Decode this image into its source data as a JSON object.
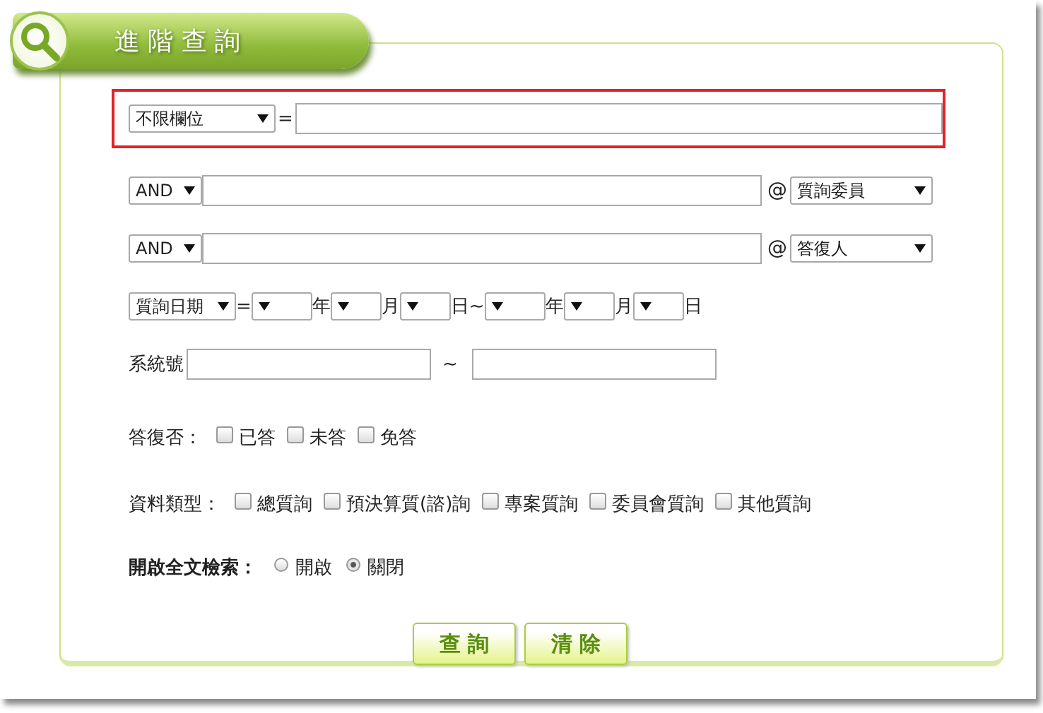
{
  "header": {
    "title": "進 階 查 詢"
  },
  "field_row": {
    "field_select": "不限欄位",
    "equals": "="
  },
  "keyword_rows": [
    {
      "logic": "AND",
      "at": "@",
      "scope": "質詢委員"
    },
    {
      "logic": "AND",
      "at": "@",
      "scope": "答復人"
    }
  ],
  "date_row": {
    "field_select": "質詢日期",
    "equals": "=",
    "units": [
      "年",
      "月",
      "日~",
      "年",
      "月",
      "日"
    ]
  },
  "serial_row": {
    "label": "系統號",
    "separator": "~"
  },
  "answer_row": {
    "label": "答復否：",
    "options": [
      {
        "label": "已答",
        "checked": false
      },
      {
        "label": "未答",
        "checked": false
      },
      {
        "label": "免答",
        "checked": false
      }
    ]
  },
  "type_row": {
    "label": "資料類型：",
    "options": [
      {
        "label": "總質詢",
        "checked": false
      },
      {
        "label": "預決算質(諮)詢",
        "checked": false
      },
      {
        "label": "專案質詢",
        "checked": false
      },
      {
        "label": "委員會質詢",
        "checked": false
      },
      {
        "label": "其他質詢",
        "checked": false
      }
    ]
  },
  "fulltext_row": {
    "label": "開啟全文檢索：",
    "options": [
      {
        "label": "開啟",
        "selected": false
      },
      {
        "label": "關閉",
        "selected": true
      }
    ]
  },
  "buttons": [
    "查 詢",
    "清 除"
  ]
}
